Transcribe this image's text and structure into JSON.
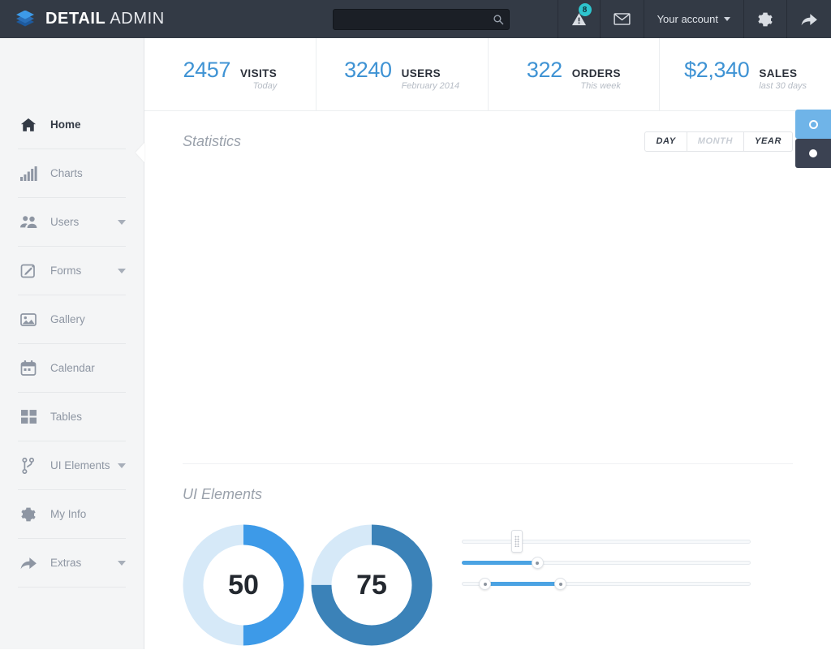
{
  "topbar": {
    "logo_icon": "layers-icon",
    "brand_bold": "DETAIL",
    "brand_light": "ADMIN",
    "search": {
      "value": "",
      "placeholder": "",
      "icon": "search-icon"
    },
    "alerts": {
      "icon": "warning-triangle-icon",
      "badge": "8",
      "badge_color": "#2ec5ce"
    },
    "messages": {
      "icon": "envelope-icon"
    },
    "account": {
      "label": "Your account",
      "icon": "chevron-down-icon"
    },
    "settings": {
      "icon": "gear-icon"
    },
    "logout": {
      "icon": "share-arrow-icon"
    }
  },
  "sidebar": {
    "items": [
      {
        "label": "Home",
        "icon": "home-icon",
        "active": true,
        "expandable": false
      },
      {
        "label": "Charts",
        "icon": "bar-chart-icon",
        "active": false,
        "expandable": false
      },
      {
        "label": "Users",
        "icon": "users-icon",
        "active": false,
        "expandable": true
      },
      {
        "label": "Forms",
        "icon": "edit-pencil-icon",
        "active": false,
        "expandable": true
      },
      {
        "label": "Gallery",
        "icon": "image-icon",
        "active": false,
        "expandable": false
      },
      {
        "label": "Calendar",
        "icon": "calendar-icon",
        "active": false,
        "expandable": false
      },
      {
        "label": "Tables",
        "icon": "grid-icon",
        "active": false,
        "expandable": false
      },
      {
        "label": "UI Elements",
        "icon": "code-branch-icon",
        "active": false,
        "expandable": true
      },
      {
        "label": "My Info",
        "icon": "gear-icon",
        "active": false,
        "expandable": false
      },
      {
        "label": "Extras",
        "icon": "share-arrow-icon",
        "active": false,
        "expandable": true
      }
    ]
  },
  "stats": [
    {
      "value": "2457",
      "label": "VISITS",
      "sub": "Today"
    },
    {
      "value": "3240",
      "label": "USERS",
      "sub": "February 2014"
    },
    {
      "value": "322",
      "label": "ORDERS",
      "sub": "This week"
    },
    {
      "value": "$2,340",
      "label": "SALES",
      "sub": "last 30 days"
    }
  ],
  "statistics": {
    "title": "Statistics",
    "range_buttons": [
      {
        "label": "DAY",
        "muted": false
      },
      {
        "label": "MONTH",
        "muted": true
      },
      {
        "label": "YEAR",
        "muted": false
      }
    ]
  },
  "ui_elements": {
    "title": "UI Elements",
    "dials": [
      {
        "value": "50",
        "percent": 50,
        "color": "#3d9ae8",
        "track": "#d6e9f8"
      },
      {
        "value": "75",
        "percent": 75,
        "color": "#3b82b8",
        "track": "#d6e9f8"
      }
    ],
    "sliders": [
      {
        "type": "single",
        "handle": "rect",
        "value": 19,
        "filled": false
      },
      {
        "type": "single",
        "handle": "round",
        "value": 26,
        "filled": true
      },
      {
        "type": "range",
        "handle": "round",
        "start": 8,
        "end": 34,
        "filled": true
      }
    ]
  },
  "side_tabs": [
    {
      "icon": "ring-icon",
      "style": "light"
    },
    {
      "icon": "dot-icon",
      "style": "dark"
    }
  ],
  "colors": {
    "topbar_bg": "#333a45",
    "sidebar_bg": "#f4f5f6",
    "accent_blue": "#3f93d4",
    "slider_blue": "#4ba3e3",
    "badge_teal": "#2ec5ce"
  }
}
